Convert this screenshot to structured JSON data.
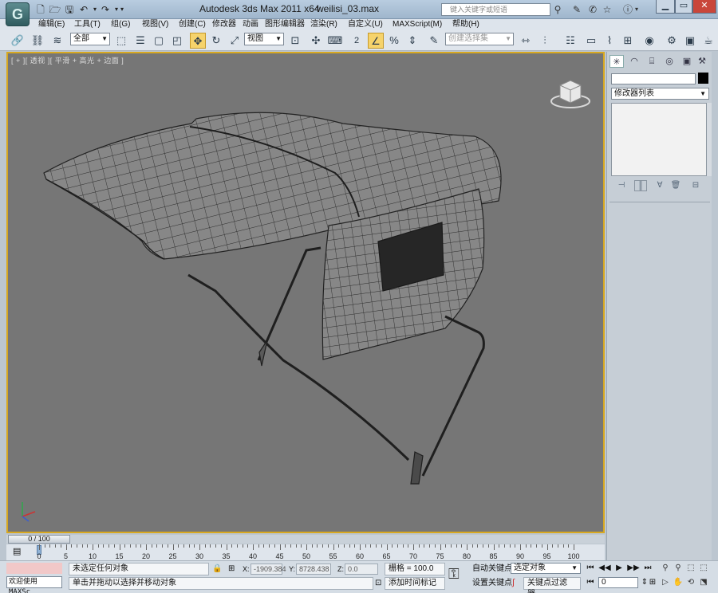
{
  "title": {
    "app": "Autodesk 3ds Max  2011 x64",
    "file": "weilisi_03.max"
  },
  "search": {
    "placeholder": "键入关键字或短语"
  },
  "menu": [
    "编辑(E)",
    "工具(T)",
    "组(G)",
    "视图(V)",
    "创建(C)",
    "修改器",
    "动画",
    "图形编辑器",
    "渲染(R)",
    "自定义(U)",
    "MAXScript(M)",
    "帮助(H)"
  ],
  "toolbar": {
    "selection_filter": "全部",
    "reference_coord": "视图",
    "snap_value": "2",
    "named_selection_placeholder": "创建选择集"
  },
  "viewport": {
    "label": "[ + ][ 透视 ][ 平滑 + 高光 + 边面 ]"
  },
  "command_panel": {
    "modifier_list": "修改器列表"
  },
  "timeline": {
    "slider_label": "0 / 100",
    "ticks": [
      "0",
      "5",
      "10",
      "15",
      "20",
      "25",
      "30",
      "35",
      "40",
      "45",
      "50",
      "55",
      "60",
      "65",
      "70",
      "75",
      "80",
      "85",
      "90",
      "95",
      "100"
    ]
  },
  "status": {
    "welcome": "欢迎使用 MAXSc",
    "message": "未选定任何对象",
    "prompt": "单击并拖动以选择并移动对象",
    "x_label": "X:",
    "x_value": "-1909.384",
    "y_label": "Y:",
    "y_value": "8728.438",
    "z_label": "Z:",
    "z_value": "0.0",
    "grid": "栅格 = 100.0",
    "add_time_tag": "添加时间标记",
    "auto_key": "自动关键点",
    "set_key": "设置关键点",
    "key_mode": "选定对象",
    "key_filters": "关键点过滤器...",
    "frame": "0"
  },
  "colors": {
    "viewport_bg": "#767676",
    "viewport_border": "#d8a820",
    "ui_bg": "#dfe5ec"
  }
}
